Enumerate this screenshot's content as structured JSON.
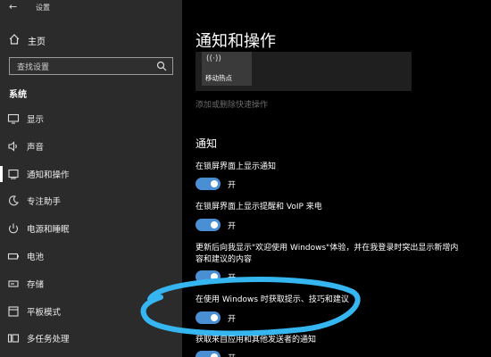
{
  "window": {
    "title": "设置",
    "back_icon": "arrow-left-icon"
  },
  "sidebar": {
    "home_label": "主页",
    "search_placeholder": "查找设置",
    "section_label": "系统",
    "items": [
      {
        "label": "显示",
        "icon": "display-icon"
      },
      {
        "label": "声音",
        "icon": "speaker-icon"
      },
      {
        "label": "通知和操作",
        "icon": "notification-icon",
        "active": true
      },
      {
        "label": "专注助手",
        "icon": "moon-icon"
      },
      {
        "label": "电源和睡眠",
        "icon": "power-icon"
      },
      {
        "label": "电池",
        "icon": "battery-icon"
      },
      {
        "label": "存储",
        "icon": "storage-icon"
      },
      {
        "label": "平板模式",
        "icon": "tablet-icon"
      },
      {
        "label": "多任务处理",
        "icon": "multitask-icon"
      }
    ]
  },
  "main": {
    "page_title": "通知和操作",
    "quick_action_tile": {
      "label": "移动热点",
      "icon": "wifi-hotspot-icon"
    },
    "edit_quick_actions_link": "添加或删除快速操作",
    "notifications_heading": "通知",
    "toggles": [
      {
        "label": "在锁屏界面上显示通知",
        "state": "开",
        "on": true
      },
      {
        "label": "在锁屏界面上显示提醒和 VoIP 来电",
        "state": "开",
        "on": true
      },
      {
        "label": "更新后向我显示\"欢迎使用 Windows\"体验，并在我登录时突出显示新增内容和建议的内容",
        "state": "开",
        "on": true
      },
      {
        "label": "在使用 Windows 时获取提示、技巧和建议",
        "state": "开",
        "on": true
      },
      {
        "label": "获取来自应用和其他发送者的通知",
        "state": "开",
        "on": true
      }
    ]
  },
  "colors": {
    "sidebar_bg": "#2b2b2b",
    "main_bg": "#000000",
    "toggle_on": "#4a8ed4",
    "highlight": "#35b6f0"
  }
}
